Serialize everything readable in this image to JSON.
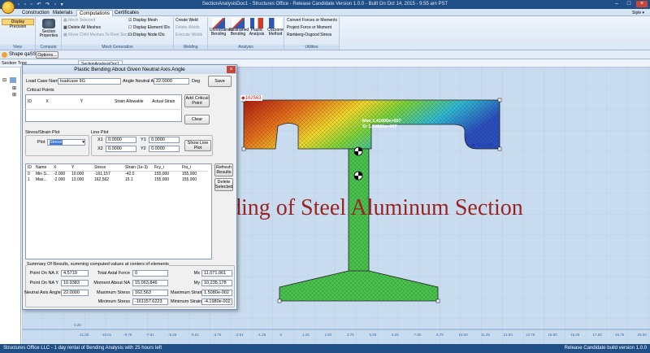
{
  "window": {
    "title": "SectionAnalysisDoc1 - Structures Office - Release Candidate Version 1.0.0 - Built On Oct 14, 2015 - 9:55 am PST",
    "style_label": "Style"
  },
  "tabs": [
    "Construction",
    "Materials",
    "Computations",
    "Certificates"
  ],
  "ribbon": {
    "display_precision": "Display Precision",
    "view_label": "View",
    "section_properties": "Section Properties",
    "compute_label": "Compute",
    "mesh_items": [
      "Mesh Selected",
      "Delete All Meshes",
      "Move Child Meshes To Root Section"
    ],
    "mesh_checks": [
      "Display Mesh",
      "Display Element IDs",
      "Display Node IDs"
    ],
    "mesh_generation_label": "Mesh Generation",
    "weld_items": [
      "Create Weld",
      "Delete Welds",
      "Execute Welds"
    ],
    "welding_label": "Welding",
    "analysis_buttons": [
      "Unrestrained Bending",
      "Restrained Bending",
      "Plastic Analysis",
      "Cozzone Method"
    ],
    "analysis_label": "Analysis",
    "util_items": [
      "Convert Forces or Moments",
      "Project Force or Moment",
      "Ramberg-Osgood Stress"
    ],
    "utilities_label": "Utilities"
  },
  "subbar": {
    "shape_label": "Shape qaSS",
    "options_label": "Options..."
  },
  "section_tree_label": "Section Tree",
  "doc_tab": "SectionAnalysisDoc1",
  "dialog": {
    "title": "Plastic Bending About Given Neutral Axis Angle",
    "load_case_label": "Load Case Name",
    "load_case_value": "loadcase 9G",
    "angle_label": "Angle Neutral Axis",
    "angle_value": "22.0000",
    "angle_unit": "Deg",
    "save_label": "Save",
    "critical_points_label": "Critical Points",
    "crit_columns": [
      "ID",
      "X",
      "Y",
      "Strain Allowable",
      "Actual Strain"
    ],
    "add_critical_label": "Add Critical Point",
    "clear_label": "Clear",
    "stress_plot_label": "Stress/Strain Plot",
    "plot_label": "Plot",
    "plot_value": "Stress",
    "line_plot_label": "Line Plot",
    "x1_label": "X1",
    "x1_value": "0.0000",
    "x2_label": "X2",
    "x2_value": "0.0000",
    "y1_label": "Y1",
    "y1_value": "0.0000",
    "y2_label": "Y2",
    "y2_value": "0.0000",
    "show_line_plot_label": "Show Line Plot",
    "results_columns": [
      "ID",
      "Name",
      "X",
      "Y",
      "Stress",
      "Strain (1e-3)",
      "Fcy_i",
      "Ftu_i"
    ],
    "results_rows": [
      [
        "0",
        "Min S...",
        "-2.000",
        "10.000",
        "-161,157",
        "-42.0",
        "155,000",
        "155,000"
      ],
      [
        "1",
        "Max...",
        "-2.000",
        "13.000",
        "162,562",
        "15.1",
        "155,000",
        "155,000"
      ]
    ],
    "refresh_label": "Refresh Results",
    "delete_selected_label": "Delete Selected",
    "summary_label": "Summary Of Results, summing computed values at centers of elements",
    "point_x_label": "Point On NA  X",
    "point_x_value": "4.5719",
    "point_y_label": "Point On NA  Y",
    "point_y_value": "10.9383",
    "neutral_angle_label": "Neutral Axis Angle",
    "neutral_angle_value": "22.0000",
    "total_axial_label": "Total Axial Force",
    "total_axial_value": "0",
    "moment_na_label": "Moment About NA",
    "moment_na_value": "15,063,846",
    "max_stress_label": "Maximum Stress",
    "max_stress_value": "162,563",
    "min_stress_label": "Minimum Stress",
    "min_stress_value": "-161157.6223",
    "mx_label": "Mx",
    "mx_value": "11,071,061",
    "my_label": "My",
    "my_value": "10,235,178",
    "max_strain_label": "Maximum Strain",
    "max_strain_value": "1.5080e-002",
    "min_strain_label": "Minimum Strain",
    "min_strain_value": "-4.1980e-002"
  },
  "canvas": {
    "marker_max": "162563",
    "marker_min": "-161158",
    "max_readout": "Max 1.41006e+007",
    "min_readout": "Sr 1.50881e+007",
    "ruler_y": "0.26",
    "ruler_x": [
      "-11.26",
      "-10.01",
      "-8.76",
      "-7.51",
      "-6.26",
      "-5.01",
      "-3.76",
      "-2.51",
      "-1.26",
      "0",
      "1.25",
      "2.50",
      "3.75",
      "5.00",
      "6.25",
      "7.50",
      "8.75",
      "10.00",
      "11.25",
      "12.50",
      "13.75",
      "15.00",
      "16.25",
      "17.50",
      "18.75",
      "20.00"
    ]
  },
  "overlay_caption": "Plastic Bending of Steel Aluminum Section",
  "status": {
    "left": "Structures Office LLC - 1 day rental of Bending Analysis with 25 hours left",
    "right": "Release Candidate build version 1.0.0"
  },
  "colors": {
    "titlebar": "#1f4f86",
    "caption": "#9a2323",
    "grid_bg": "#c9dcef"
  }
}
